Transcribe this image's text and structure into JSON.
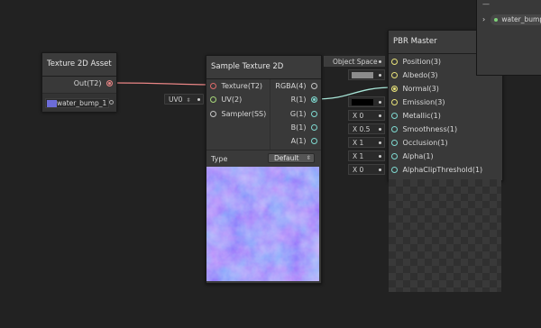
{
  "texture_asset_node": {
    "title": "Texture 2D Asset",
    "out_port": "Out(T2)",
    "texture_name": "water_bump_1"
  },
  "sample_node": {
    "title": "Sample Texture 2D",
    "inputs": [
      "Texture(T2)",
      "UV(2)",
      "Sampler(SS)"
    ],
    "outputs": [
      "RGBA(4)",
      "R(1)",
      "G(1)",
      "B(1)",
      "A(1)"
    ],
    "uv_field": "UV0",
    "type_label": "Type",
    "type_value": "Default"
  },
  "pbr_node": {
    "title": "PBR Master",
    "ports": [
      "Position(3)",
      "Albedo(3)",
      "Normal(3)",
      "Emission(3)",
      "Metallic(1)",
      "Smoothness(1)",
      "Occlusion(1)",
      "Alpha(1)",
      "AlphaClipThreshold(1)"
    ],
    "position_field": "Object Space",
    "metallic_field": "X 0",
    "smoothness_field": "X 0.5",
    "occlusion_field": "X 1",
    "alpha_field": "X 1",
    "alpha_clip_field": "X 0"
  },
  "blackboard": {
    "title": "—",
    "property": "water_bump_"
  },
  "colors": {
    "background": "#222222",
    "node": "#393939",
    "texture_wire": "#e98585",
    "vector_wire": "#a8e6d8",
    "albedo_swatch": "#8c8c8c",
    "emission_swatch": "#000000",
    "texture_swatch": "#6c6cd8"
  },
  "icons": {
    "blackboard_expand": "chevron-right-icon",
    "dropdown": "dropdown-arrows-icon"
  }
}
